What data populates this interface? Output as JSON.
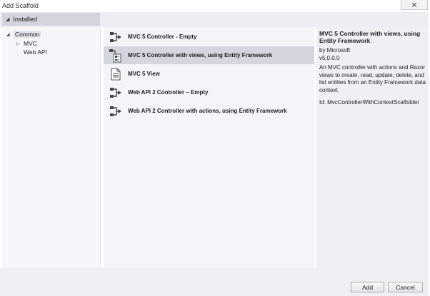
{
  "window": {
    "title": "Add Scaffold",
    "close_glyph": "×"
  },
  "sidebar": {
    "root_label": "Installed",
    "items": [
      {
        "label": "Common",
        "expander": "◢"
      },
      {
        "label": "MVC",
        "expander": "▷"
      },
      {
        "label": "Web API",
        "expander": ""
      }
    ]
  },
  "templates": {
    "items": [
      {
        "label": "MVC 5 Controller - Empty",
        "icon": "controller-icon"
      },
      {
        "label": "MVC 5 Controller with views, using Entity Framework",
        "icon": "controller-views-icon",
        "selected": true
      },
      {
        "label": "MVC 5 View",
        "icon": "view-document-icon"
      },
      {
        "label": "Web API 2 Controller – Empty",
        "icon": "controller-icon"
      },
      {
        "label": "Web API 2 Controller with actions, using Entity Framework",
        "icon": "controller-icon"
      }
    ]
  },
  "details": {
    "title": "MVC 5 Controller with views, using Entity Framework",
    "author": "by Microsoft",
    "version": "v5.0.0.0",
    "description": "An MVC controller with actions and Razor views to create, read, update, delete, and list entities from an Entity Framework data context.",
    "id": "Id: MvcControllerWithContextScaffolder"
  },
  "footer": {
    "add_label": "Add",
    "cancel_label": "Cancel"
  },
  "colors": {
    "selected_row": "#d3d5df",
    "header_band": "#eeeef2",
    "list_bg": "#f5f5f7"
  }
}
